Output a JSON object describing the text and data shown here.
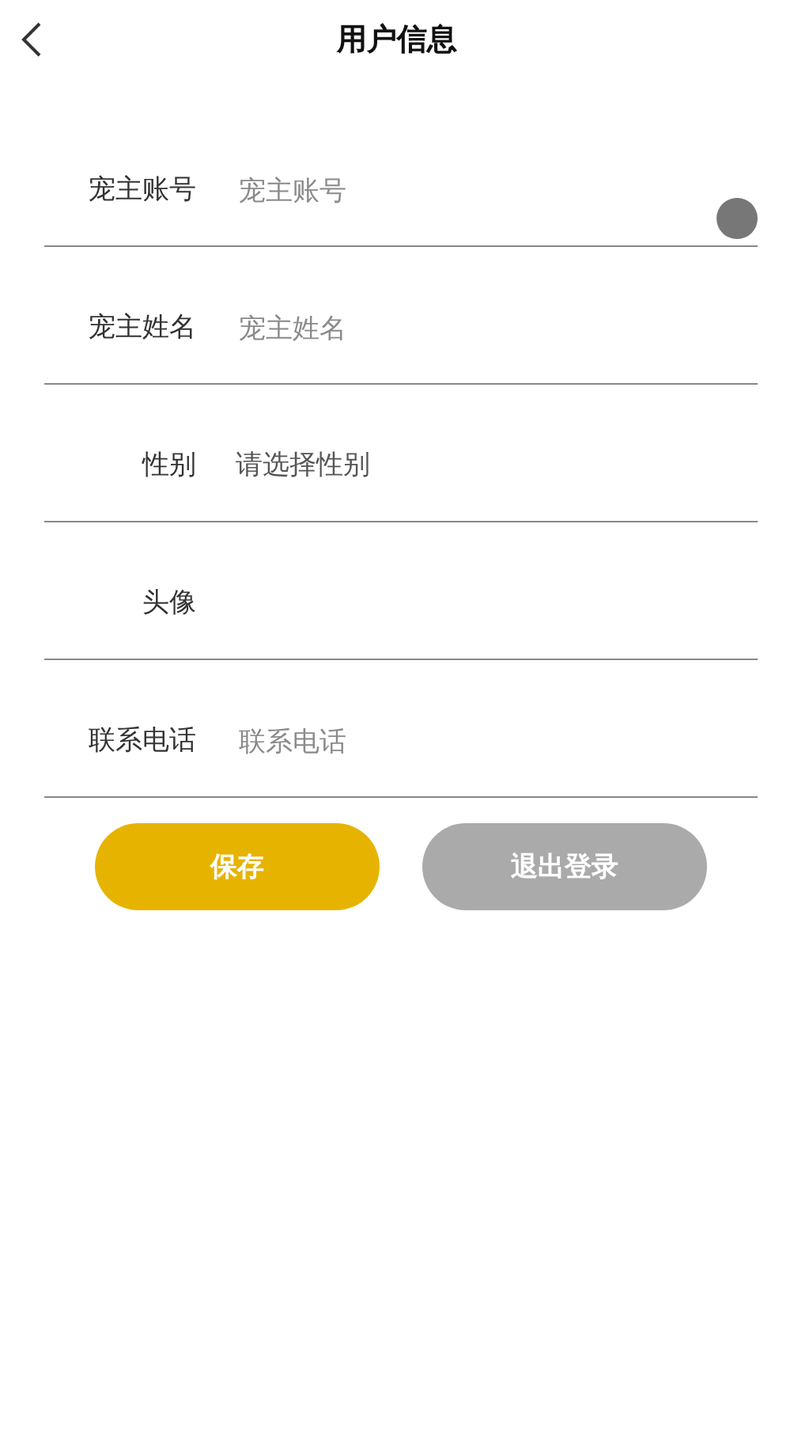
{
  "header": {
    "title": "用户信息"
  },
  "fields": [
    {
      "kind": "input",
      "label": "宠主账号",
      "placeholder": "宠主账号",
      "dot": true
    },
    {
      "kind": "input",
      "label": "宠主姓名",
      "placeholder": "宠主姓名",
      "dot": false
    },
    {
      "kind": "select",
      "label": "性别",
      "placeholder": "请选择性别",
      "dot": false
    },
    {
      "kind": "avatar",
      "label": "头像",
      "dot": false
    },
    {
      "kind": "input",
      "label": "联系电话",
      "placeholder": "联系电话",
      "dot": false
    }
  ],
  "buttons": [
    {
      "kind": "primary",
      "label": "保存"
    },
    {
      "kind": "secondary",
      "label": "退出登录"
    }
  ]
}
